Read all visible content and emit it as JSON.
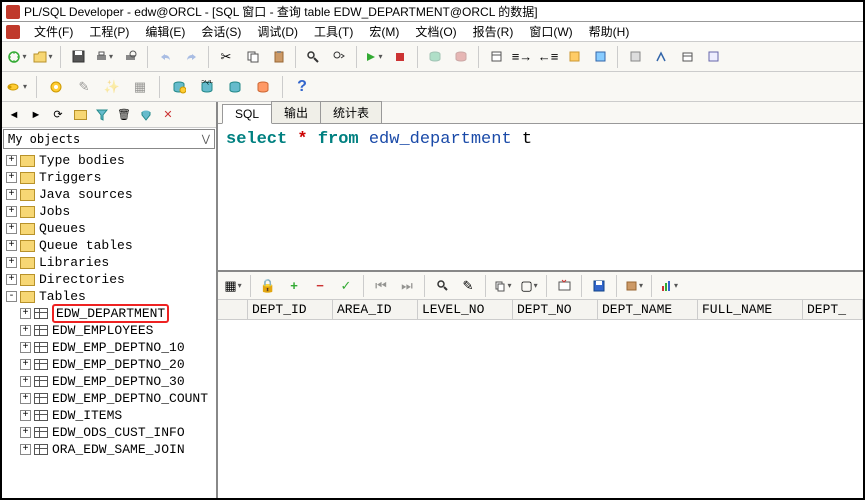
{
  "title": "PL/SQL Developer - edw@ORCL - [SQL 窗口 - 查询 table EDW_DEPARTMENT@ORCL 的数据]",
  "menus": [
    "文件(F)",
    "工程(P)",
    "编辑(E)",
    "会话(S)",
    "调试(D)",
    "工具(T)",
    "宏(M)",
    "文档(O)",
    "报告(R)",
    "窗口(W)",
    "帮助(H)"
  ],
  "sidebar": {
    "combo": "My objects",
    "folders": [
      "Type bodies",
      "Triggers",
      "Java sources",
      "Jobs",
      "Queues",
      "Queue tables",
      "Libraries",
      "Directories"
    ],
    "tables_label": "Tables",
    "tables": [
      "EDW_DEPARTMENT",
      "EDW_EMPLOYEES",
      "EDW_EMP_DEPTNO_10",
      "EDW_EMP_DEPTNO_20",
      "EDW_EMP_DEPTNO_30",
      "EDW_EMP_DEPTNO_COUNT",
      "EDW_ITEMS",
      "EDW_ODS_CUST_INFO",
      "ORA_EDW_SAME_JOIN"
    ],
    "highlighted": "EDW_DEPARTMENT"
  },
  "tabs": [
    "SQL",
    "输出",
    "统计表"
  ],
  "sql": {
    "select": "select",
    "star": "*",
    "from": "from",
    "table": "edw_department",
    "alias": "t"
  },
  "columns": [
    "",
    "DEPT_ID",
    "AREA_ID",
    "LEVEL_NO",
    "DEPT_NO",
    "DEPT_NAME",
    "FULL_NAME",
    "DEPT_"
  ],
  "help_q": "?"
}
